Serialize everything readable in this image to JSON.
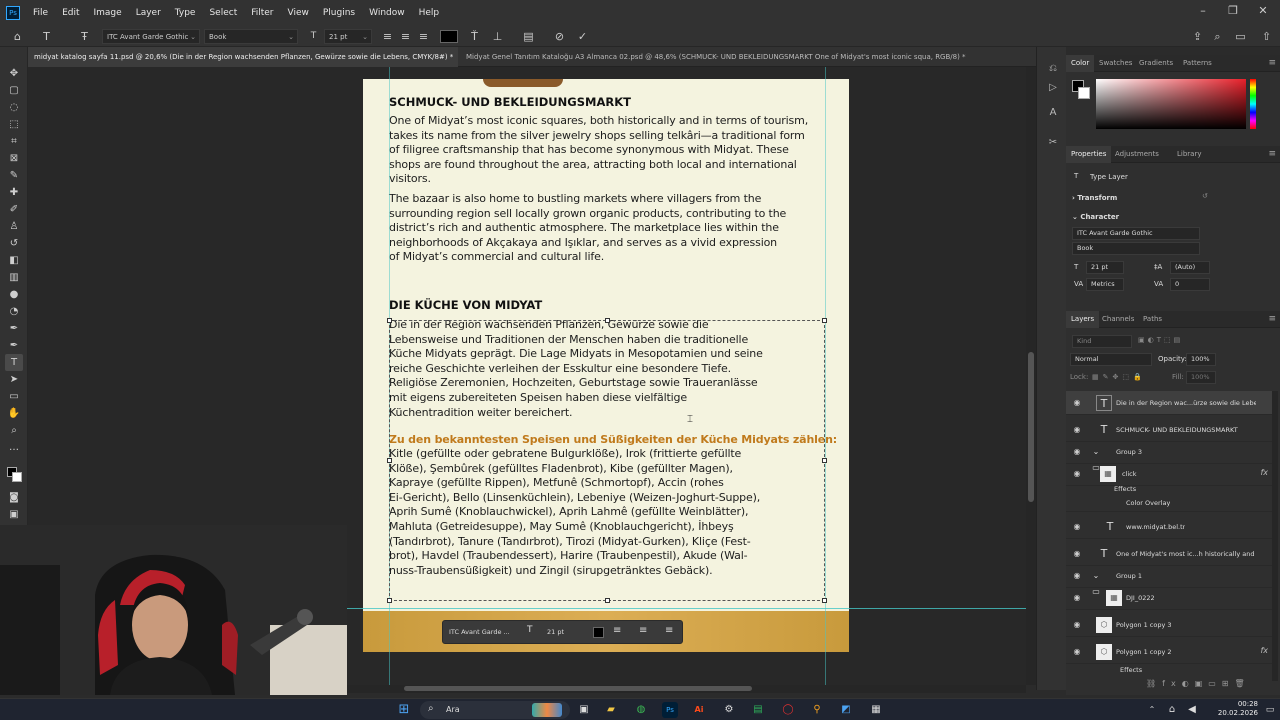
{
  "menubar": {
    "app_icon": "Ps",
    "items": [
      "File",
      "Edit",
      "Image",
      "Layer",
      "Type",
      "Select",
      "Filter",
      "View",
      "Plugins",
      "Window",
      "Help"
    ],
    "window_buttons": [
      "minimize",
      "restore",
      "close"
    ]
  },
  "options_bar": {
    "font_family": "ITC Avant Garde Gothic",
    "font_style": "Book",
    "font_size": "21 pt",
    "color_swatch": "#000000"
  },
  "tabs": [
    {
      "label": "midyat katalog sayfa 11.psd @ 20,6% (Die in der Region wachsenden Pflanzen, Gewürze sowie die Lebens, CMYK/8#) *",
      "active": true
    },
    {
      "label": "Midyat Genel Tanıtım Kataloğu A3 Almanca 02.psd @ 48,6% (SCHMUCK- UND BEKLEIDUNGSMARKT  One of Midyat's most iconic squa, RGB/8) *",
      "active": false
    }
  ],
  "document": {
    "heading1": "SCHMUCK- UND BEKLEIDUNGSMARKT",
    "para1": "One of Midyat’s most iconic squares, both historically and in terms of tourism,\ntakes its name from the silver jewelry shops selling telkâri—a traditional form\nof filigree craftsmanship that has become synonymous with Midyat. These\nshops are found throughout the area, attracting both local and international\nvisitors.",
    "para2": "The bazaar is also home to bustling markets where villagers from the\nsurrounding region sell locally grown organic products, contributing to the\ndistrict’s rich and authentic atmosphere. The marketplace lies within the\nneighborhoods of Akçakaya and Işıklar, and serves as a vivid expression\nof Midyat’s commercial and cultural life.",
    "heading2": "DIE KÜCHE VON MIDYAT",
    "para3": "Die in der Region wachsenden Pflanzen, Gewürze sowie die\nLebensweise und Traditionen der Menschen haben die traditionelle\nKüche Midyats geprägt. Die Lage Midyats in Mesopotamien und seine\nreiche Geschichte verleihen der Esskultur eine besondere Tiefe.\nReligiöse Zeremonien, Hochzeiten, Geburtstage sowie Traueranlässe\nmit eigens zubereiteten Speisen haben diese vielfältige\nKüchentradition weiter bereichert.",
    "para4_title": "Zu den bekanntesten Speisen und Süßigkeiten der Küche Midyats zählen:",
    "para4": "Kitle (gefüllte oder gebratene Bulgurklöße), Irok (frittierte gefüllte\nKlöße), Şembûrek (gefülltes Fladenbrot), Kibe (gefüllter Magen),\nKapraye (gefüllte Rippen), Metfunê (Schmortopf), Accin (rohes\nEi-Gericht), Bello (Linsenküchlein), Lebeniye (Weizen-Joghurt-Suppe),\nAprih Sumê (Knoblauchwickel), Aprih Lahmê (gefüllte Weinblätter),\nMahluta (Getreidesuppe), May Sumê (Knoblauchgericht), İhbeyş\n(Tandırbrot), Tanure (Tandırbrot), Tirozi (Midyat-Gurken), Kliçe (Fest-\nbrot), Havdel (Traubendessert), Harire (Traubenpestil), Akude (Wal-\nnuss-Traubensüßigkeit) und Zingil (sirupgetränktes Gebäck).",
    "accent_color": "#c07a1c"
  },
  "context_bar": {
    "font_family": "ITC Avant Garde ...",
    "font_size": "21 pt"
  },
  "color_panel": {
    "tabs": [
      "Color",
      "Swatches",
      "Gradients",
      "Patterns"
    ],
    "foreground": "#000000",
    "background": "#ffffff"
  },
  "properties_panel": {
    "tabs": [
      "Properties",
      "Adjustments",
      "Library"
    ],
    "layer_type": "Type Layer",
    "transform_label": "Transform",
    "character_label": "Character",
    "font_family": "ITC Avant Garde Gothic",
    "font_style": "Book",
    "font_size": "21 pt",
    "leading": "(Auto)",
    "kerning": "Metrics",
    "tracking": "0"
  },
  "layers_panel": {
    "tabs": [
      "Layers",
      "Channels",
      "Paths"
    ],
    "search_placeholder": "Kind",
    "blend_mode": "Normal",
    "opacity_label": "Opacity:",
    "opacity": "100%",
    "lock_label": "Lock:",
    "fill_label": "Fill:",
    "fill": "100%",
    "layers": [
      {
        "name": "Die in der Region wac...ürze sowie die Lebens",
        "kind": "T",
        "selected": true
      },
      {
        "name": "SCHMUCK- UND BEKLEIDUNGSMARKT",
        "kind": "T"
      },
      {
        "name": "Group 3",
        "kind": "group"
      },
      {
        "name": "click",
        "kind": "img",
        "fx": "fx"
      },
      {
        "name": "Effects",
        "kind": "effects"
      },
      {
        "name": "Color Overlay",
        "kind": "effect"
      },
      {
        "name": "www.midyat.bel.tr",
        "kind": "T"
      },
      {
        "name": "One of Midyat's most ic...h historically and in t",
        "kind": "T"
      },
      {
        "name": "Group 1",
        "kind": "group"
      },
      {
        "name": "DJI_0222",
        "kind": "img"
      },
      {
        "name": "Polygon 1 copy 3",
        "kind": "shape"
      },
      {
        "name": "Polygon 1 copy 2",
        "kind": "shape",
        "fx": "fx"
      },
      {
        "name": "Effects",
        "kind": "effects"
      }
    ]
  },
  "taskbar": {
    "search_label": "Ara",
    "time": "00:28",
    "date": "20.02.2026"
  }
}
